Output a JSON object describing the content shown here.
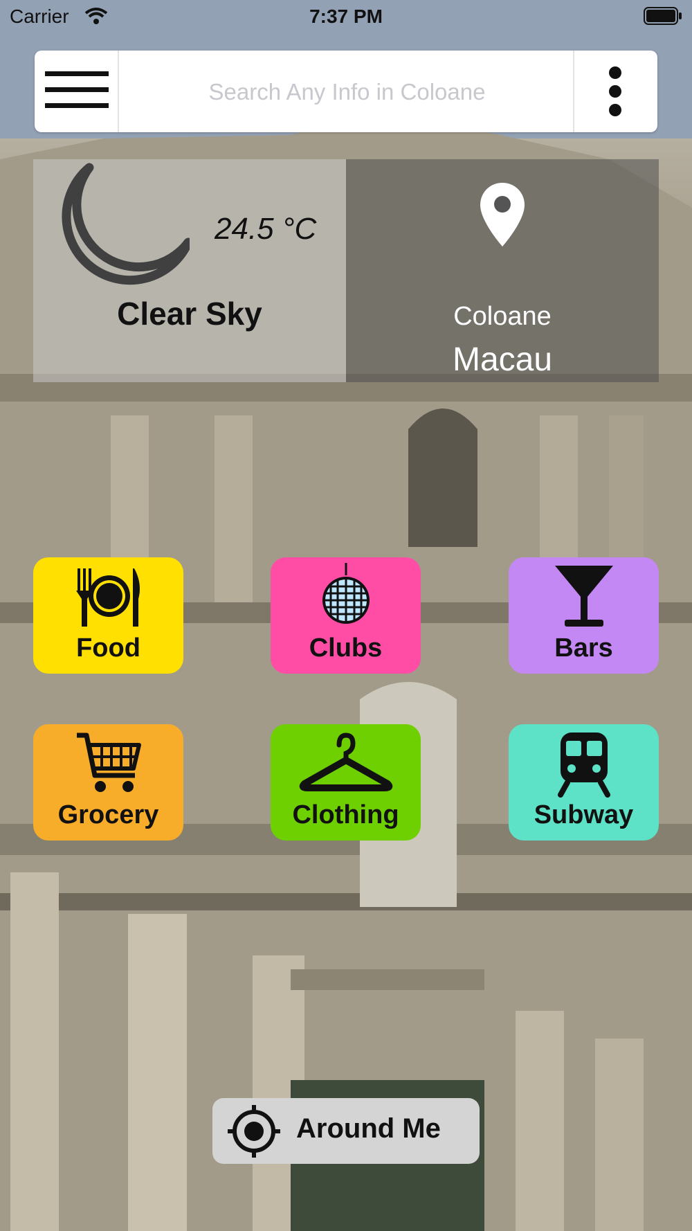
{
  "status_bar": {
    "carrier": "Carrier",
    "time": "7:37 PM"
  },
  "search": {
    "placeholder": "Search Any Info in Coloane"
  },
  "weather": {
    "temperature": "24.5 °C",
    "condition": "Clear Sky",
    "icon": "moon-icon"
  },
  "location": {
    "area": "Coloane",
    "city": "Macau",
    "icon": "location-pin-icon"
  },
  "categories": [
    {
      "label": "Food",
      "icon": "fork-plate-knife-icon",
      "color": "#ffe000"
    },
    {
      "label": "Clubs",
      "icon": "disco-ball-icon",
      "color": "#ff4da6"
    },
    {
      "label": "Bars",
      "icon": "cocktail-glass-icon",
      "color": "#c488f5"
    },
    {
      "label": "Grocery",
      "icon": "shopping-cart-icon",
      "color": "#f8ad2a"
    },
    {
      "label": "Clothing",
      "icon": "hanger-icon",
      "color": "#6ed000"
    },
    {
      "label": "Subway",
      "icon": "train-icon",
      "color": "#5de2c7"
    }
  ],
  "around_me": {
    "label": "Around Me",
    "icon": "crosshair-icon"
  }
}
